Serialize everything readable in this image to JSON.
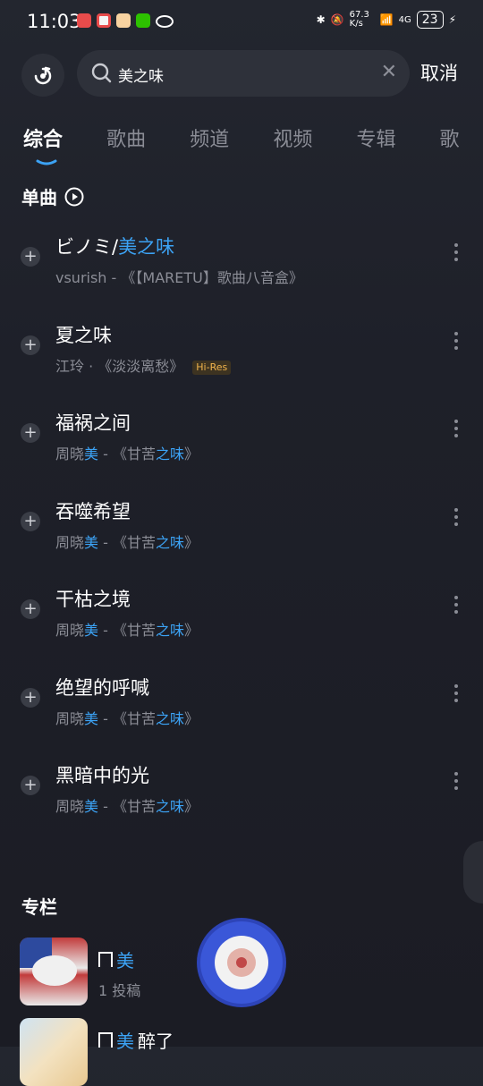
{
  "status": {
    "time": "11:03",
    "net_speed": "67.3 K/s",
    "network": "4G",
    "battery": "23"
  },
  "search": {
    "value": "美之味",
    "cancel_label": "取消"
  },
  "tabs": [
    "综合",
    "歌曲",
    "频道",
    "视频",
    "专辑",
    "歌"
  ],
  "singles_header": "单曲",
  "songs": [
    {
      "title_pre": "ビノミ/",
      "title_hl": "美之味",
      "sub_parts": [
        [
          "vsurish - 《【MARETU】歌曲八音盒》",
          ""
        ]
      ],
      "hires": ""
    },
    {
      "title_pre": "夏之味",
      "title_hl": "",
      "sub_parts": [
        [
          "江玲 · 《淡淡离愁》",
          ""
        ]
      ],
      "hires": "Hi-Res"
    },
    {
      "title_pre": "福祸之间",
      "title_hl": "",
      "sub_parts": [
        [
          "周晓",
          ""
        ],
        [
          "美",
          "hl"
        ],
        [
          " - 《甘苦",
          ""
        ],
        [
          "之味",
          "hl"
        ],
        [
          "》",
          ""
        ]
      ],
      "hires": ""
    },
    {
      "title_pre": "吞噬希望",
      "title_hl": "",
      "sub_parts": [
        [
          "周晓",
          ""
        ],
        [
          "美",
          "hl"
        ],
        [
          " - 《甘苦",
          ""
        ],
        [
          "之味",
          "hl"
        ],
        [
          "》",
          ""
        ]
      ],
      "hires": ""
    },
    {
      "title_pre": "干枯之境",
      "title_hl": "",
      "sub_parts": [
        [
          "周晓",
          ""
        ],
        [
          "美",
          "hl"
        ],
        [
          " - 《甘苦",
          ""
        ],
        [
          "之味",
          "hl"
        ],
        [
          "》",
          ""
        ]
      ],
      "hires": ""
    },
    {
      "title_pre": "绝望的呼喊",
      "title_hl": "",
      "sub_parts": [
        [
          "周晓",
          ""
        ],
        [
          "美",
          "hl"
        ],
        [
          " - 《甘苦",
          ""
        ],
        [
          "之味",
          "hl"
        ],
        [
          "》",
          ""
        ]
      ],
      "hires": ""
    },
    {
      "title_pre": "黑暗中的光",
      "title_hl": "",
      "sub_parts": [
        [
          "周晓",
          ""
        ],
        [
          "美",
          "hl"
        ],
        [
          " - 《甘苦",
          ""
        ],
        [
          "之味",
          "hl"
        ],
        [
          "》",
          ""
        ]
      ],
      "hires": ""
    }
  ],
  "columns_header": "专栏",
  "columns": [
    {
      "title_hl": "美",
      "title_rest": "",
      "count": "1 投稿"
    },
    {
      "title_hl": "美",
      "title_rest": "醉了",
      "count": ""
    }
  ],
  "colors": {
    "accent_highlight": "#3ca3f5",
    "tab_indicator": "#31c27c",
    "hires_badge": "#f1b44c",
    "background": "#1e2029"
  }
}
